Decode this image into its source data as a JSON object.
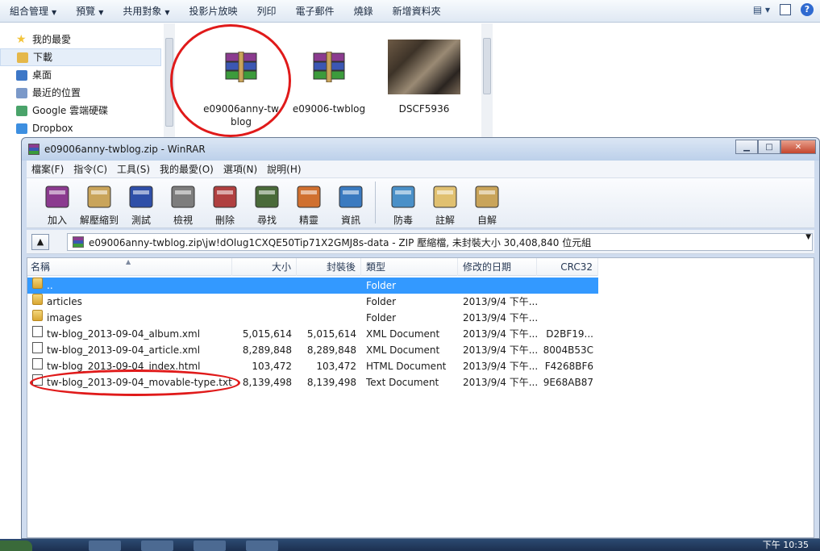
{
  "explorer": {
    "toolbar": [
      {
        "label": "組合管理",
        "arrow": true
      },
      {
        "label": "預覽",
        "arrow": true
      },
      {
        "label": "共用對象",
        "arrow": true
      },
      {
        "label": "投影片放映",
        "arrow": false
      },
      {
        "label": "列印",
        "arrow": false
      },
      {
        "label": "電子郵件",
        "arrow": false
      },
      {
        "label": "燒錄",
        "arrow": false
      },
      {
        "label": "新增資料夾",
        "arrow": false
      }
    ],
    "nav": [
      {
        "label": "我的最愛",
        "icon": "star-icon",
        "color": "#f3c43a"
      },
      {
        "label": "下載",
        "icon": "download-folder-icon",
        "color": "#e5b84a",
        "selected": true
      },
      {
        "label": "桌面",
        "icon": "desktop-icon",
        "color": "#3d77c7"
      },
      {
        "label": "最近的位置",
        "icon": "recent-places-icon",
        "color": "#7b99c9"
      },
      {
        "label": "Google 雲端硬碟",
        "icon": "google-drive-icon",
        "color": "#4aa36a"
      },
      {
        "label": "Dropbox",
        "icon": "dropbox-icon",
        "color": "#3d8fe0"
      }
    ],
    "files": [
      {
        "name_line1": "e09006anny-tw",
        "name_line2": "blog",
        "type": "rar"
      },
      {
        "name_line1": "e09006-twblog",
        "name_line2": "",
        "type": "rar"
      },
      {
        "name_line1": "DSCF5936",
        "name_line2": "",
        "type": "photo"
      }
    ]
  },
  "winrar": {
    "title": "e09006anny-twblog.zip - WinRAR",
    "menu": [
      "檔案(F)",
      "指令(C)",
      "工具(S)",
      "我的最愛(O)",
      "選項(N)",
      "說明(H)"
    ],
    "tools": [
      {
        "label": "加入",
        "icon": "add-icon"
      },
      {
        "label": "解壓縮到",
        "icon": "extract-to-icon"
      },
      {
        "label": "測試",
        "icon": "test-icon"
      },
      {
        "label": "檢視",
        "icon": "view-icon"
      },
      {
        "label": "刪除",
        "icon": "delete-icon"
      },
      {
        "label": "尋找",
        "icon": "find-icon"
      },
      {
        "label": "精靈",
        "icon": "wizard-icon"
      },
      {
        "label": "資訊",
        "icon": "info-icon"
      },
      {
        "label": "防毒",
        "icon": "virus-scan-icon"
      },
      {
        "label": "註解",
        "icon": "comment-icon"
      },
      {
        "label": "自解",
        "icon": "sfx-icon"
      }
    ],
    "address": "e09006anny-twblog.zip\\jw!dOlug1CXQE50Tip71X2GMJ8s-data - ZIP 壓縮檔, 未封裝大小 30,408,840 位元組",
    "columns": {
      "name": "名稱",
      "size": "大小",
      "packed": "封裝後",
      "type": "類型",
      "modified": "修改的日期",
      "crc": "CRC32"
    },
    "rows": [
      {
        "name": "..",
        "size": "",
        "packed": "",
        "type": "Folder",
        "modified": "",
        "crc": "",
        "icon": "folder",
        "selected": true
      },
      {
        "name": "articles",
        "size": "",
        "packed": "",
        "type": "Folder",
        "modified": "2013/9/4 下午...",
        "crc": "",
        "icon": "folder"
      },
      {
        "name": "images",
        "size": "",
        "packed": "",
        "type": "Folder",
        "modified": "2013/9/4 下午...",
        "crc": "",
        "icon": "folder"
      },
      {
        "name": "tw-blog_2013-09-04_album.xml",
        "size": "5,015,614",
        "packed": "5,015,614",
        "type": "XML Document",
        "modified": "2013/9/4 下午...",
        "crc": "D2BF19...",
        "icon": "file"
      },
      {
        "name": "tw-blog_2013-09-04_article.xml",
        "size": "8,289,848",
        "packed": "8,289,848",
        "type": "XML Document",
        "modified": "2013/9/4 下午...",
        "crc": "8004B53C",
        "icon": "file"
      },
      {
        "name": "tw-blog_2013-09-04_index.html",
        "size": "103,472",
        "packed": "103,472",
        "type": "HTML Document",
        "modified": "2013/9/4 下午...",
        "crc": "F4268BF6",
        "icon": "file"
      },
      {
        "name": "tw-blog_2013-09-04_movable-type.txt",
        "size": "8,139,498",
        "packed": "8,139,498",
        "type": "Text Document",
        "modified": "2013/9/4 下午...",
        "crc": "9E68AB87",
        "icon": "file"
      }
    ]
  },
  "taskbar": {
    "time": "下午 10:35"
  }
}
